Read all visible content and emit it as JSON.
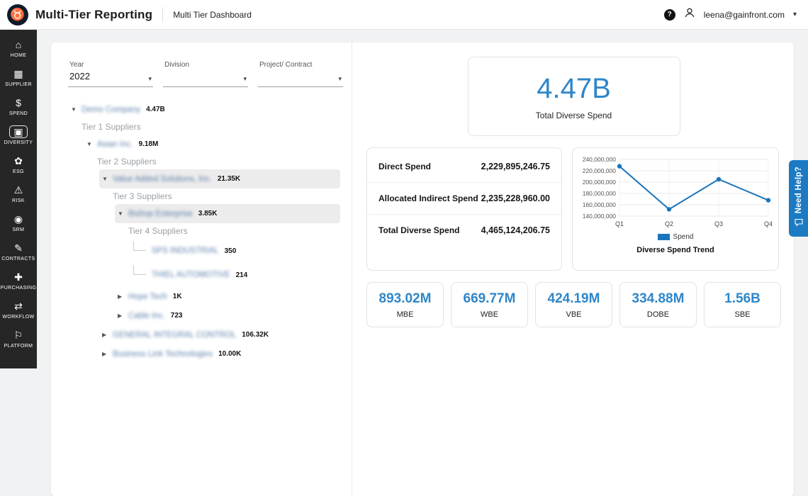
{
  "header": {
    "app_title": "Multi-Tier Reporting",
    "breadcrumb": "Multi Tier Dashboard",
    "help_glyph": "?",
    "user_email": "leena@gainfront.com"
  },
  "sidebar": {
    "items": [
      {
        "label": "HOME",
        "icon": "home-icon",
        "active": false
      },
      {
        "label": "SUPPLIER",
        "icon": "supplier-icon",
        "active": false
      },
      {
        "label": "SPEND",
        "icon": "spend-icon",
        "active": false
      },
      {
        "label": "DIVERSITY",
        "icon": "diversity-icon",
        "active": true
      },
      {
        "label": "ESG",
        "icon": "esg-icon",
        "active": false
      },
      {
        "label": "RISK",
        "icon": "risk-icon",
        "active": false
      },
      {
        "label": "SRM",
        "icon": "srm-icon",
        "active": false
      },
      {
        "label": "CONTRACTS",
        "icon": "contracts-icon",
        "active": false
      },
      {
        "label": "PURCHASING",
        "icon": "purchasing-icon",
        "active": false
      },
      {
        "label": "WORKFLOW",
        "icon": "workflow-icon",
        "active": false
      },
      {
        "label": "PLATFORM",
        "icon": "platform-icon",
        "active": false
      }
    ]
  },
  "filters": {
    "year_label": "Year",
    "year_value": "2022",
    "division_label": "Division",
    "division_value": "",
    "project_label": "Project/ Contract",
    "project_value": ""
  },
  "tree": {
    "rows": [
      {
        "type": "node",
        "level": 0,
        "expanded": true,
        "name": "Demo Company",
        "amount": "4.47B",
        "blurred": true,
        "highlighted": false
      },
      {
        "type": "tier",
        "level": 0,
        "label": "Tier 1 Suppliers"
      },
      {
        "type": "node",
        "level": 1,
        "expanded": true,
        "name": "Asian Inc.",
        "amount": "9.18M",
        "blurred": true,
        "highlighted": false
      },
      {
        "type": "tier",
        "level": 1,
        "label": "Tier 2 Suppliers"
      },
      {
        "type": "node",
        "level": 2,
        "expanded": true,
        "name": "Value Added Solutions, Inc.",
        "amount": "21.35K",
        "blurred": true,
        "highlighted": true
      },
      {
        "type": "tier",
        "level": 2,
        "label": "Tier 3 Suppliers"
      },
      {
        "type": "node",
        "level": 3,
        "expanded": true,
        "name": "Bishop Enterprise",
        "amount": "3.85K",
        "blurred": true,
        "highlighted": true
      },
      {
        "type": "tier",
        "level": 3,
        "label": "Tier 4 Suppliers"
      },
      {
        "type": "leaf",
        "level": 4,
        "name": "SPS INDUSTRIAL",
        "amount": "350",
        "blurred": true
      },
      {
        "type": "leaf",
        "level": 4,
        "name": "THIEL AUTOMOTIVE",
        "amount": "214",
        "blurred": true
      },
      {
        "type": "node",
        "level": 3,
        "expanded": false,
        "name": "Hope Tech",
        "amount": "1K",
        "blurred": true,
        "highlighted": false
      },
      {
        "type": "node",
        "level": 3,
        "expanded": false,
        "name": "Cable Inc.",
        "amount": "723",
        "blurred": true,
        "highlighted": false
      },
      {
        "type": "node",
        "level": 2,
        "expanded": false,
        "name": "GENERAL INTEGRAL CONTROL",
        "amount": "106.32K",
        "blurred": true,
        "highlighted": false
      },
      {
        "type": "node",
        "level": 2,
        "expanded": false,
        "name": "Business Link Technologies",
        "amount": "10.00K",
        "blurred": true,
        "highlighted": false
      }
    ]
  },
  "summary": {
    "total_value": "4.47B",
    "total_label": "Total Diverse Spend"
  },
  "spend_table": {
    "rows": [
      {
        "label": "Direct Spend",
        "value": "2,229,895,246.75"
      },
      {
        "label": "Allocated Indirect Spend",
        "value": "2,235,228,960.00"
      },
      {
        "label": "Total Diverse Spend",
        "value": "4,465,124,206.75"
      }
    ]
  },
  "chart_data": {
    "type": "line",
    "x": [
      "Q1",
      "Q2",
      "Q3",
      "Q4"
    ],
    "series": [
      {
        "name": "Spend",
        "values": [
          228000000,
          152000000,
          205000000,
          168000000
        ]
      }
    ],
    "title": "Diverse Spend Trend",
    "xlabel": "",
    "ylabel": "",
    "ylim": [
      140000000,
      240000000
    ],
    "yticks": [
      140000000,
      160000000,
      180000000,
      200000000,
      220000000,
      240000000
    ],
    "grid": true,
    "legend_position": "bottom",
    "line_color": "#1b75bb"
  },
  "metrics": [
    {
      "value": "893.02M",
      "label": "MBE"
    },
    {
      "value": "669.77M",
      "label": "WBE"
    },
    {
      "value": "424.19M",
      "label": "VBE"
    },
    {
      "value": "334.88M",
      "label": "DOBE"
    },
    {
      "value": "1.56B",
      "label": "SBE"
    }
  ],
  "need_help": {
    "label": "Need Help?"
  },
  "colors": {
    "accent": "#2e86c9",
    "line": "#1b75bb",
    "sidebar_bg": "#262626"
  }
}
